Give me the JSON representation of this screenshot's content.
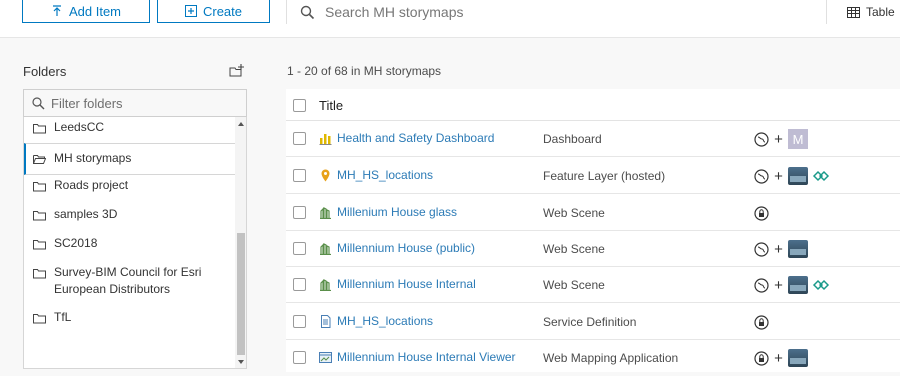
{
  "toolbar": {
    "add_item_label": "Add Item",
    "create_label": "Create",
    "search_placeholder": "Search MH storymaps",
    "view_label": "Table"
  },
  "sidebar": {
    "title": "Folders",
    "filter_placeholder": "Filter folders",
    "folders": [
      {
        "label": "LeedsCC",
        "active": false
      },
      {
        "label": "MH storymaps",
        "active": true
      },
      {
        "label": "Roads project",
        "active": false
      },
      {
        "label": "samples 3D",
        "active": false
      },
      {
        "label": "SC2018",
        "active": false
      },
      {
        "label": "Survey-BIM Council for Esri European Distributors",
        "active": false
      },
      {
        "label": "TfL",
        "active": false
      }
    ]
  },
  "main": {
    "count_text": "1 - 20 of 68 in MH storymaps",
    "column_title": "Title",
    "rows": [
      {
        "title": "Health and Safety Dashboard",
        "type": "Dashboard",
        "item_icon": "dashboard-icon",
        "sharing": "public-icon",
        "groups": [
          "m-group-thumbnail"
        ],
        "group_letter": "M"
      },
      {
        "title": "MH_HS_locations",
        "type": "Feature Layer (hosted)",
        "item_icon": "feature-layer-icon",
        "sharing": "public-icon",
        "groups": [
          "photo-group-thumbnail",
          "logo-group-thumbnail"
        ]
      },
      {
        "title": "Millenium House glass",
        "type": "Web Scene",
        "item_icon": "web-scene-icon",
        "sharing": "private-icon",
        "groups": []
      },
      {
        "title": "Millennium House (public)",
        "type": "Web Scene",
        "item_icon": "web-scene-icon",
        "sharing": "public-icon",
        "groups": [
          "photo-group-thumbnail"
        ]
      },
      {
        "title": "Millennium House Internal",
        "type": "Web Scene",
        "item_icon": "web-scene-icon",
        "sharing": "public-icon",
        "groups": [
          "photo-group-thumbnail",
          "logo-group-thumbnail"
        ]
      },
      {
        "title": "MH_HS_locations",
        "type": "Service Definition",
        "item_icon": "service-definition-icon",
        "sharing": "private-icon",
        "groups": []
      },
      {
        "title": "Millennium House Internal Viewer",
        "type": "Web Mapping Application",
        "item_icon": "web-app-icon",
        "sharing": "private-icon",
        "groups": [
          "photo-group-thumbnail"
        ]
      }
    ]
  },
  "colors": {
    "accent": "#0079c1",
    "link": "#2c7bb6",
    "dashboard_icon": "#e0b800",
    "feature_icon": "#e8a21b",
    "scene_icon": "#5a8f4a"
  }
}
